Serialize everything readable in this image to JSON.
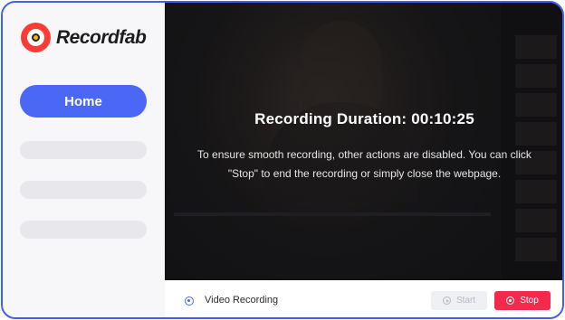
{
  "app": {
    "name": "Recordfab",
    "accent_color": "#4a68f5",
    "brand_color": "#fb3c34"
  },
  "sidebar": {
    "home_label": "Home"
  },
  "recording": {
    "title": "Recording Duration: 00:10:25",
    "message": "To ensure smooth recording, other actions are disabled. You can click \"Stop\" to end the recording or simply close the webpage."
  },
  "footer": {
    "mode_label": "Video Recording",
    "start_label": "Start",
    "stop_label": "Stop",
    "stop_color": "#f5294c"
  }
}
